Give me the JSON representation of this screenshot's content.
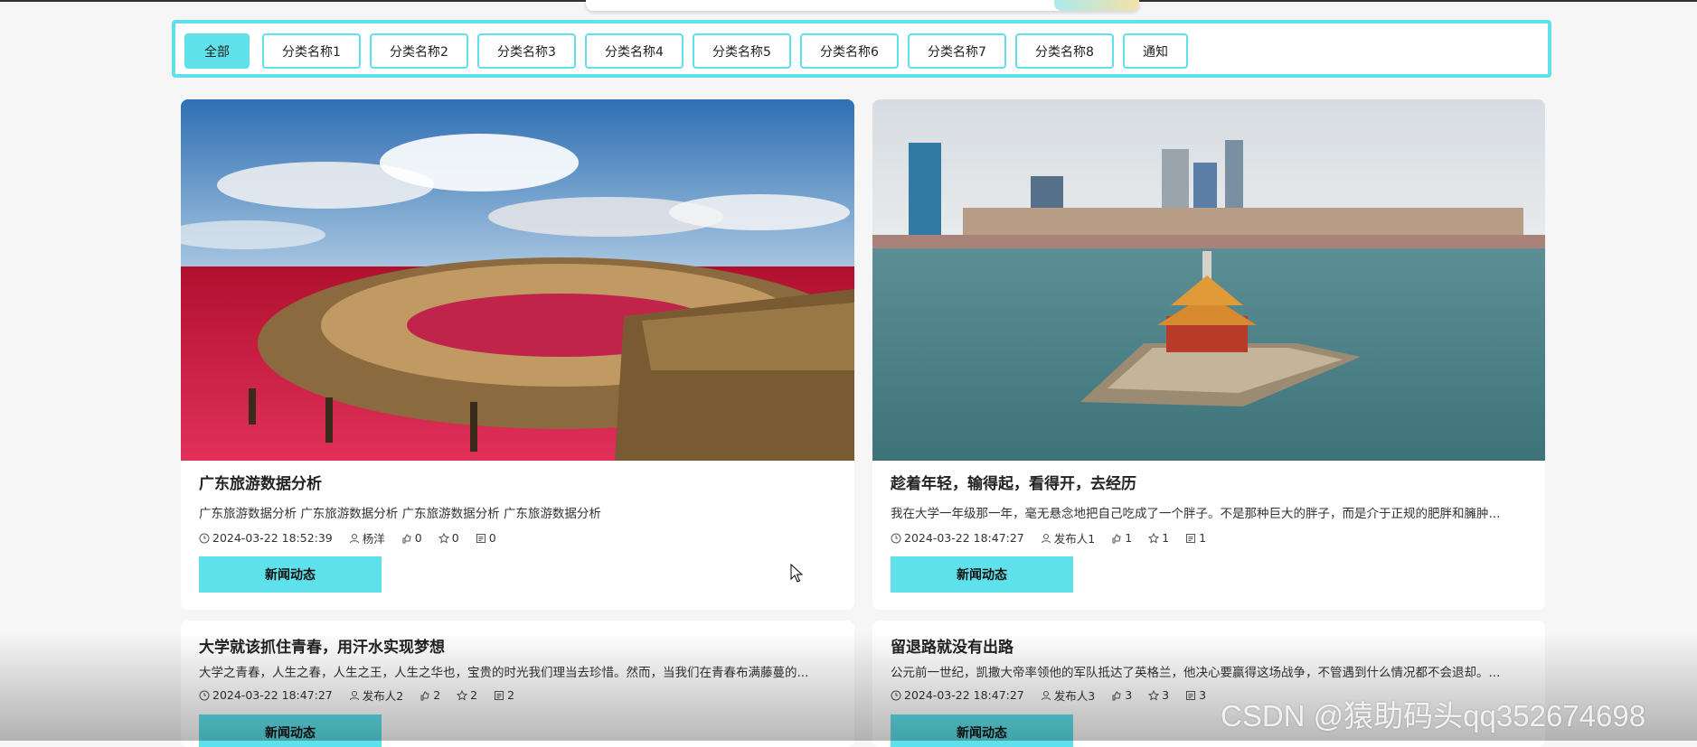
{
  "categories": [
    {
      "label": "全部",
      "active": true
    },
    {
      "label": "分类名称1"
    },
    {
      "label": "分类名称2"
    },
    {
      "label": "分类名称3"
    },
    {
      "label": "分类名称4"
    },
    {
      "label": "分类名称5"
    },
    {
      "label": "分类名称6"
    },
    {
      "label": "分类名称7"
    },
    {
      "label": "分类名称8"
    },
    {
      "label": "通知"
    }
  ],
  "cards": [
    {
      "title": "广东旅游数据分析",
      "desc": "广东旅游数据分析 广东旅游数据分析 广东旅游数据分析 广东旅游数据分析",
      "time": "2024-03-22 18:52:39",
      "author": "杨洋",
      "likes": "0",
      "favs": "0",
      "comments": "0",
      "button": "新闻动态"
    },
    {
      "title": "趁着年轻，输得起，看得开，去经历",
      "desc": "我在大学一年级那一年，毫无悬念地把自己吃成了一个胖子。不是那种巨大的胖子，而是介于正规的肥胖和臃肿...",
      "time": "2024-03-22 18:47:27",
      "author": "发布人1",
      "likes": "1",
      "favs": "1",
      "comments": "1",
      "button": "新闻动态"
    },
    {
      "title": "大学就该抓住青春，用汗水实现梦想",
      "desc": "大学之青春，人生之春，人生之王，人生之华也，宝贵的时光我们理当去珍惜。然而，当我们在青春布满藤蔓的...",
      "time": "2024-03-22 18:47:27",
      "author": "发布人2",
      "likes": "2",
      "favs": "2",
      "comments": "2",
      "button": "新闻动态"
    },
    {
      "title": "留退路就没有出路",
      "desc": "公元前一世纪，凯撒大帝率领他的军队抵达了英格兰，他决心要赢得这场战争，不管遇到什么情况都不会退却。...",
      "time": "2024-03-22 18:47:27",
      "author": "发布人3",
      "likes": "3",
      "favs": "3",
      "comments": "3",
      "button": "新闻动态"
    }
  ],
  "watermark": "CSDN @猿助码头qq352674698",
  "colors": {
    "accent": "#5ee1ea"
  }
}
